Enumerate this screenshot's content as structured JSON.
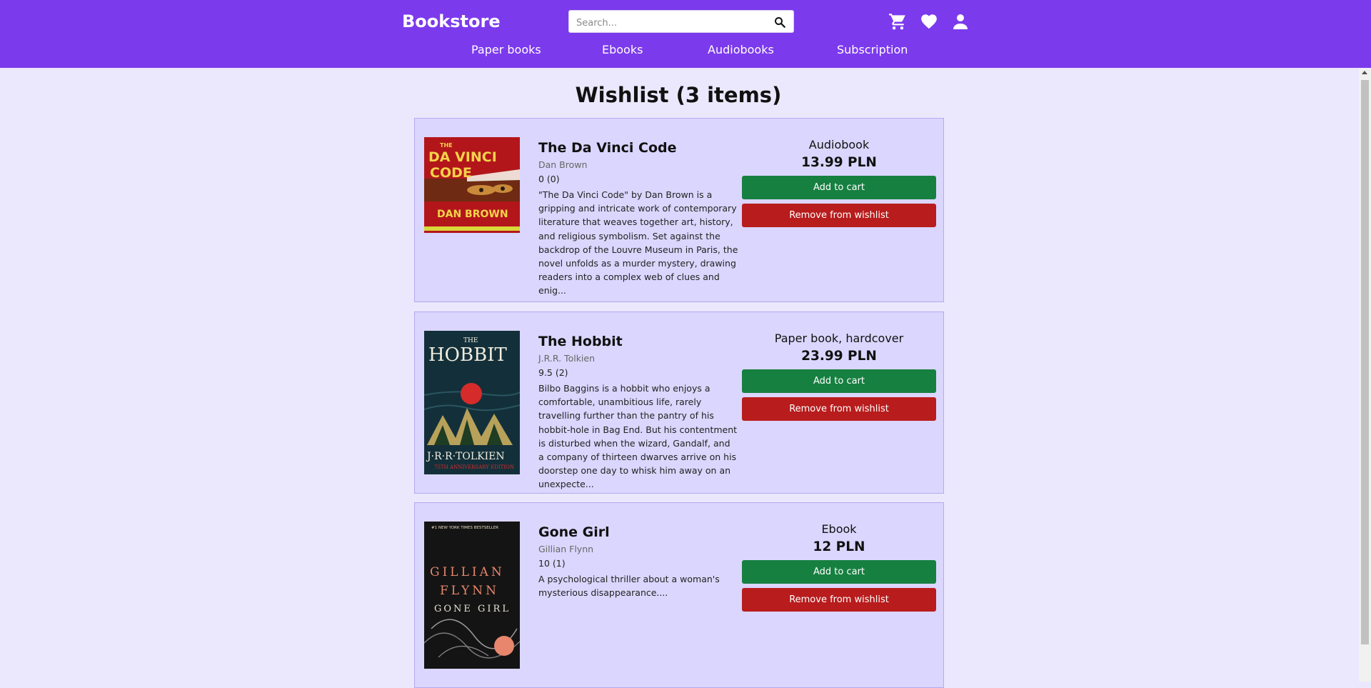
{
  "header": {
    "brand": "Bookstore",
    "search_placeholder": "Search...",
    "icons": [
      "search-icon",
      "cart-icon",
      "heart-icon",
      "user-icon"
    ],
    "nav": [
      "Paper books",
      "Ebooks",
      "Audiobooks",
      "Subscription"
    ],
    "colors": {
      "header_bg": "#7c3aed",
      "add_button": "#168040",
      "remove_button": "#b81c1c",
      "card_bg": "#dbd6fd"
    }
  },
  "wishlist": {
    "title": "Wishlist (3 items)",
    "items": [
      {
        "title": "The Da Vinci Code",
        "author": "Dan Brown",
        "rating": "0 (0)",
        "description": "\"The Da Vinci Code\" by Dan Brown is a gripping and intricate work of contemporary literature that weaves together art, history, and religious symbolism. Set against the backdrop of the Louvre Museum in Paris, the novel unfolds as a murder mystery, drawing readers into a complex web of clues and enig...",
        "format": "Audiobook",
        "price": "13.99 PLN",
        "add_label": "Add to cart",
        "remove_label": "Remove from wishlist",
        "cover_lines": [
          "THE",
          "DA VINCI",
          "CODE",
          "DAN BROWN"
        ]
      },
      {
        "title": "The Hobbit",
        "author": "J.R.R. Tolkien",
        "rating": "9.5 (2)",
        "description": "Bilbo Baggins is a hobbit who enjoys a comfortable, unambitious life, rarely travelling further than the pantry of his hobbit-hole in Bag End. But his contentment is disturbed when the wizard, Gandalf, and a company of thirteen dwarves arrive on his doorstep one day to whisk him away on an unexpecte...",
        "format": "Paper book, hardcover",
        "price": "23.99 PLN",
        "add_label": "Add to cart",
        "remove_label": "Remove from wishlist",
        "cover_lines": [
          "THE",
          "HOBBIT",
          "J·R·R·TOLKIEN",
          "75TH ANNIVERSARY EDITION"
        ]
      },
      {
        "title": "Gone Girl",
        "author": "Gillian Flynn",
        "rating": "10 (1)",
        "description": "A psychological thriller about a woman's mysterious disappearance....",
        "format": "Ebook",
        "price": "12 PLN",
        "add_label": "Add to cart",
        "remove_label": "Remove from wishlist",
        "cover_lines": [
          "#1 NEW YORK TIMES BESTSELLER",
          "GILLIAN",
          "FLYNN",
          "GONE GIRL"
        ]
      }
    ]
  }
}
